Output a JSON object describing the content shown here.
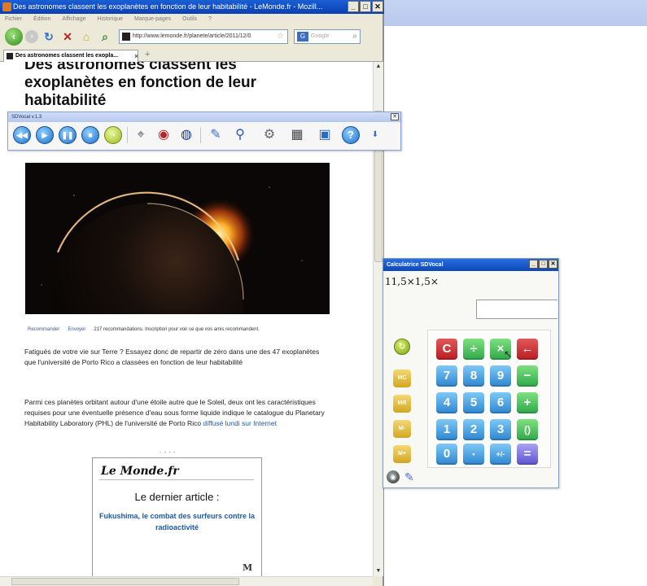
{
  "browser": {
    "title": "Des astronomes classent les exoplanètes en fonction de leur habitabilité - LeMonde.fr - Mozill...",
    "window_buttons": [
      "_",
      "□",
      "✕"
    ],
    "menu": [
      "Fichier",
      "Édition",
      "Affichage",
      "Historique",
      "Marque-pages",
      "Outils",
      "?"
    ],
    "url": "http://www.lemonde.fr/planete/article/2011/12/0",
    "search_placeholder": "Google",
    "tab_label": "Des astronomes classent les exopla...",
    "tab_close": "×",
    "new_tab": "+"
  },
  "article": {
    "headline": "Des astronomes classent les exoplanètes en fonction de leur habitabilité",
    "share_recommend": "Recommander",
    "share_send": "Envoyer",
    "share_text": "217 recommandations. Inscription pour voir ce que vos amis recommandent.",
    "paragraph1": "Fatigués de votre vie sur Terre ? Essayez donc de repartir de zéro dans une des 47 exoplanètes que l'université de Porto Rico a classées en fonction de leur habitabilité",
    "paragraph2_text": "Parmi ces planètes orbitant autour d'une étoile autre que le Soleil, deux ont les caractéristiques requises pour une éventuelle présence d'eau sous forme liquide indique le catalogue du Planetary Habitability Laboratory (PHL) de l'université de Porto Rico ",
    "paragraph2_link": "diffusé lundi sur Internet",
    "promo_logo": "Le Monde.fr",
    "promo_title": "Le dernier article :",
    "promo_link": "Fukushima, le combat des surfeurs contre la radioactivité",
    "promo_mark": "M"
  },
  "sdvocal": {
    "title": "SDVocal v.1.3",
    "close": "✕"
  },
  "calculator": {
    "title": "Calculatrice SDVocal",
    "window_buttons": [
      "_",
      "□",
      "✕"
    ],
    "expression": "11,5×1,5×",
    "result": "",
    "memory": [
      "MC",
      "MR",
      "M-",
      "M+"
    ],
    "keys": [
      [
        "C",
        "÷",
        "×",
        "←"
      ],
      [
        "7",
        "8",
        "9",
        "−"
      ],
      [
        "4",
        "5",
        "6",
        "+"
      ],
      [
        "1",
        "2",
        "3",
        "()"
      ],
      [
        "0",
        "•",
        "+/-",
        "="
      ]
    ],
    "colors": {
      "red": "#c8292d",
      "green": "#44b84f",
      "blue": "#3f95da",
      "purple": "#6c66dd",
      "memory": "#e0b83a"
    }
  }
}
